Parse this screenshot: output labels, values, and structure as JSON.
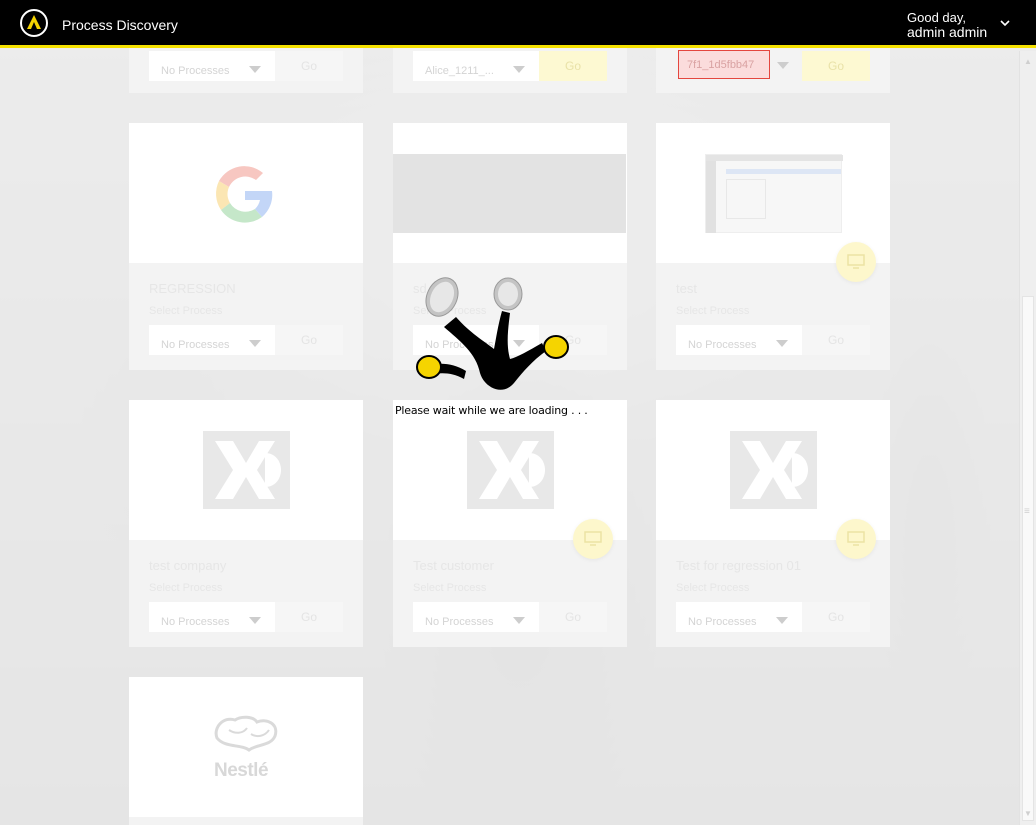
{
  "header": {
    "app_title": "Process Discovery",
    "greeting_line1": "Good day,",
    "greeting_line2": "admin admin"
  },
  "colors": {
    "accent": "#f5e100",
    "header_bg": "#000000"
  },
  "loading": {
    "message": "Please wait while we are loading . . ."
  },
  "top_row": [
    {
      "dropdown": "No Processes",
      "go": "Go"
    },
    {
      "dropdown": "Alice_1211_...",
      "go": "Go"
    },
    {
      "field": "7f1_1d5fbb47",
      "go": "Go"
    }
  ],
  "common": {
    "select_label": "Select Process",
    "go": "Go",
    "no_processes": "No Processes"
  },
  "cards": [
    {
      "name": "REGRESSION",
      "logo": "google-logo"
    },
    {
      "name": "sd",
      "logo": "gray-banner"
    },
    {
      "name": "test",
      "logo": "screenshot-thumbnail"
    },
    {
      "name": "test company",
      "logo": "dxc-logo"
    },
    {
      "name": "Test customer",
      "logo": "dxc-logo"
    },
    {
      "name": "Test for regression 01",
      "logo": "dxc-logo"
    },
    {
      "name": "",
      "logo": "nestle-logo",
      "logo_text": "Nestlé"
    }
  ]
}
